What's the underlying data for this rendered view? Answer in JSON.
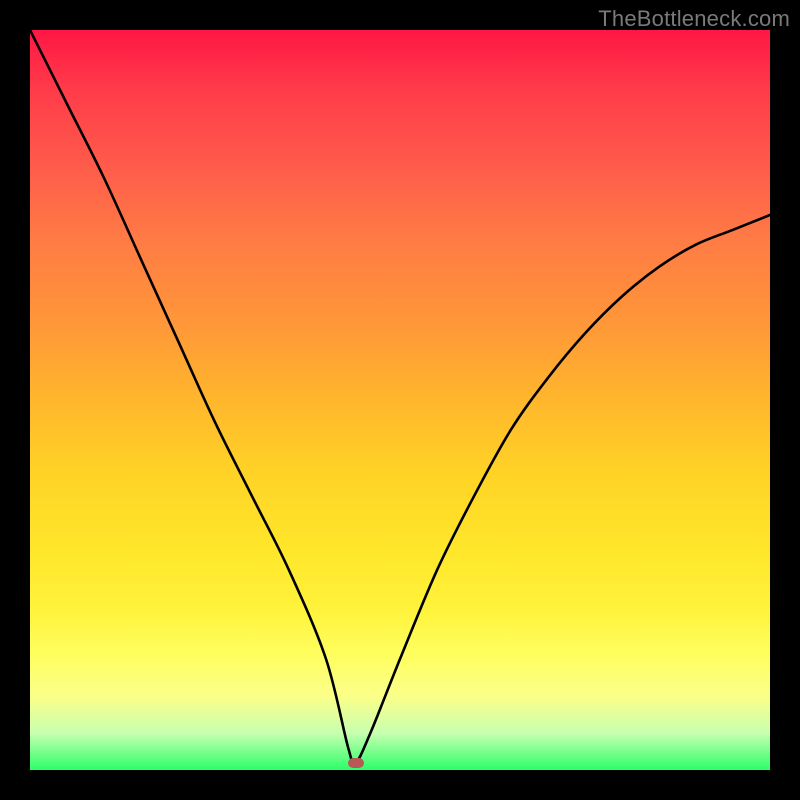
{
  "watermark": "TheBottleneck.com",
  "chart_data": {
    "type": "line",
    "title": "",
    "xlabel": "",
    "ylabel": "",
    "xlim": [
      0,
      100
    ],
    "ylim": [
      0,
      100
    ],
    "grid": false,
    "legend": false,
    "gradient_stops": [
      {
        "pct": 0,
        "color": "#ff1744"
      },
      {
        "pct": 50,
        "color": "#ffd326"
      },
      {
        "pct": 84,
        "color": "#fffe5c"
      },
      {
        "pct": 100,
        "color": "#2cff6a"
      }
    ],
    "marker": {
      "x": 44,
      "y": 1,
      "color": "#b75a57"
    },
    "series": [
      {
        "name": "bottleneck-curve",
        "x": [
          0,
          5,
          10,
          15,
          20,
          25,
          30,
          35,
          40,
          43,
          44,
          46,
          50,
          55,
          60,
          65,
          70,
          75,
          80,
          85,
          90,
          95,
          100
        ],
        "values": [
          100,
          90,
          80,
          69,
          58,
          47,
          37,
          27,
          15,
          3,
          1,
          5,
          15,
          27,
          37,
          46,
          53,
          59,
          64,
          68,
          71,
          73,
          75
        ]
      }
    ]
  }
}
